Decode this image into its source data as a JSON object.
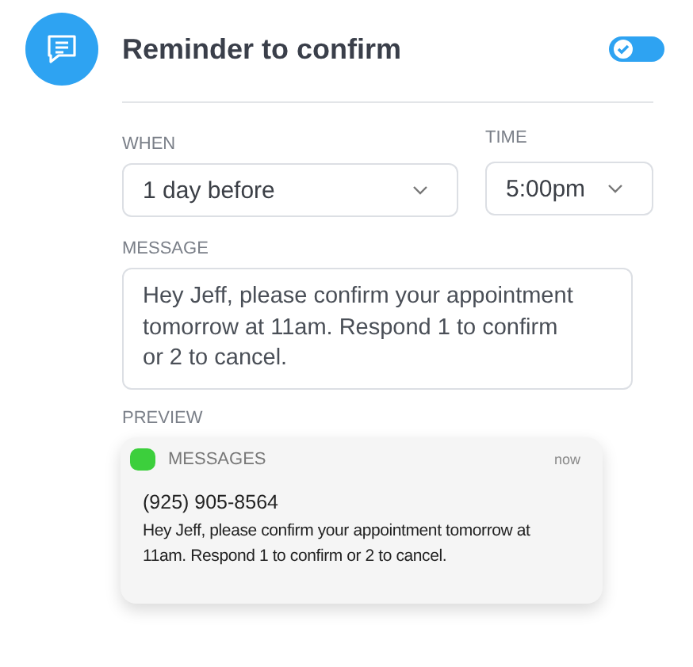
{
  "header": {
    "title": "Reminder to confirm",
    "enabled": {
      "on": true
    }
  },
  "when": {
    "label": "WHEN",
    "value": "1 day before"
  },
  "time": {
    "label": "TIME",
    "value": "5:00pm"
  },
  "message": {
    "label": "MESSAGE",
    "value": "Hey Jeff, please confirm your appointment tomorrow at 11am. Respond 1 to confirm or 2 to cancel."
  },
  "preview": {
    "label": "PREVIEW",
    "app": "MESSAGES",
    "time": "now",
    "sender": "(925) 905-8564",
    "body": "Hey Jeff, please confirm your appointment tomorrow at 11am. Respond 1 to confirm or 2 to cancel."
  }
}
